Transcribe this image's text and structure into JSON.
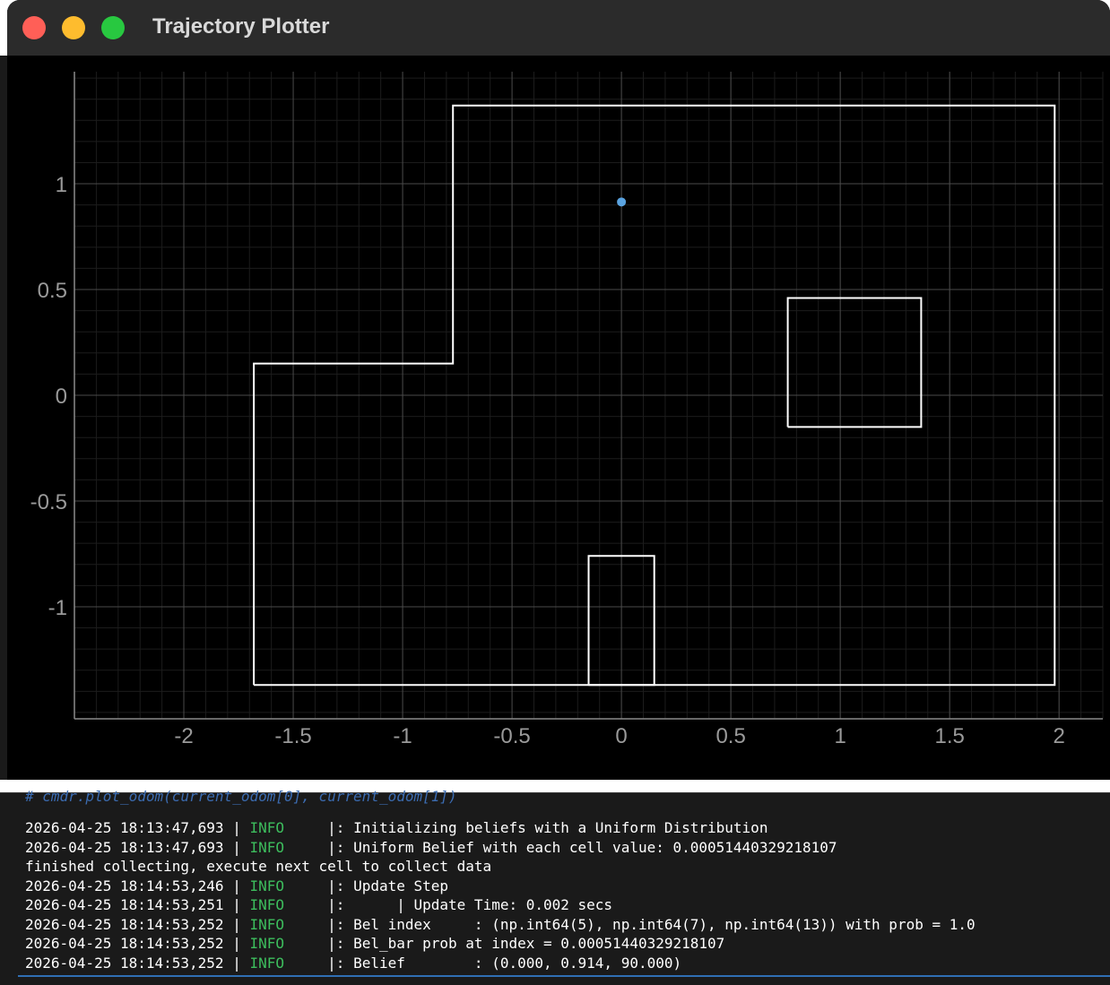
{
  "window": {
    "title": "Trajectory Plotter"
  },
  "chart_data": {
    "type": "line",
    "xlim": [
      -2.5,
      2.2
    ],
    "ylim": [
      -1.53,
      1.53
    ],
    "x_ticks": [
      "-2",
      "-1.5",
      "-1",
      "-0.5",
      "0",
      "0.5",
      "1",
      "1.5",
      "2"
    ],
    "y_ticks": [
      "1",
      "0.5",
      "0",
      "-0.5",
      "-1"
    ],
    "grid": true,
    "series": [
      {
        "points": [
          [
            -1.68,
            -1.37
          ],
          [
            1.98,
            -1.37
          ],
          [
            1.98,
            1.37
          ],
          [
            -0.77,
            1.37
          ],
          [
            -0.77,
            0.15
          ],
          [
            -1.68,
            0.15
          ],
          [
            -1.68,
            -1.37
          ]
        ],
        "color": "#ffffff"
      },
      {
        "points": [
          [
            0.76,
            -0.15
          ],
          [
            1.37,
            -0.15
          ],
          [
            1.37,
            0.46
          ],
          [
            0.76,
            0.46
          ],
          [
            0.76,
            -0.15
          ]
        ],
        "color": "#ffffff"
      },
      {
        "points": [
          [
            -0.15,
            -1.37
          ],
          [
            0.15,
            -1.37
          ],
          [
            0.15,
            -0.76
          ],
          [
            -0.15,
            -0.76
          ],
          [
            -0.15,
            -1.37
          ]
        ],
        "color": "#ffffff"
      }
    ],
    "scatter": [
      {
        "x": 0.0,
        "y": 0.914,
        "color": "#5aa3e0"
      }
    ]
  },
  "console": {
    "comment": "# cmdr.plot_odom(current_odom[0], current_odom[1])",
    "lines": [
      {
        "ts": "2026-04-25 18:13:47,693",
        "level": "INFO",
        "msg": "|: Initializing beliefs with a Uniform Distribution"
      },
      {
        "ts": "2026-04-25 18:13:47,693",
        "level": "INFO",
        "msg": "|: Uniform Belief with each cell value: 0.00051440329218107"
      },
      {
        "plain": "finished collecting, execute next cell to collect data"
      },
      {
        "ts": "2026-04-25 18:14:53,246",
        "level": "INFO",
        "msg": "|: Update Step"
      },
      {
        "ts": "2026-04-25 18:14:53,251",
        "level": "INFO",
        "msg": "|:      | Update Time: 0.002 secs"
      },
      {
        "ts": "2026-04-25 18:14:53,252",
        "level": "INFO",
        "msg": "|: Bel index     : (np.int64(5), np.int64(7), np.int64(13)) with prob = 1.0"
      },
      {
        "ts": "2026-04-25 18:14:53,252",
        "level": "INFO",
        "msg": "|: Bel_bar prob at index = 0.00051440329218107"
      },
      {
        "ts": "2026-04-25 18:14:53,252",
        "level": "INFO",
        "msg": "|: Belief        : (0.000, 0.914, 90.000)"
      }
    ]
  },
  "colors": {
    "window_bg": "#000000",
    "titlebar_bg": "#2b2b2b",
    "info_level": "#3dbd5d",
    "point": "#5aa3e0"
  }
}
